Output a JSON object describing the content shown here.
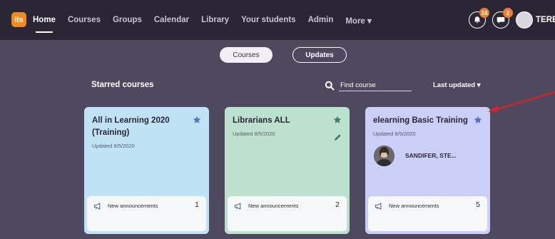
{
  "app": {
    "logo_text": "its"
  },
  "nav": {
    "items": [
      {
        "label": "Home",
        "active": true
      },
      {
        "label": "Courses",
        "active": false
      },
      {
        "label": "Groups",
        "active": false
      },
      {
        "label": "Calendar",
        "active": false
      },
      {
        "label": "Library",
        "active": false
      },
      {
        "label": "Your students",
        "active": false
      },
      {
        "label": "Admin",
        "active": false
      },
      {
        "label": "More ▾",
        "active": false
      }
    ],
    "notifications_count": "18",
    "messages_count": "2",
    "user_name": "TERES"
  },
  "toggle": {
    "courses_label": "Courses",
    "updates_label": "Updates"
  },
  "section": {
    "title": "Starred courses",
    "search_placeholder": "Find course",
    "sort_label": "Last updated ▾"
  },
  "cards": [
    {
      "title": "All in Learning 2020 (Training)",
      "updated": "Updated 8/5/2020",
      "announcements_label": "New announcements",
      "announcements_count": "1"
    },
    {
      "title": "Librarians ALL",
      "updated": "Updated 8/5/2020",
      "announcements_label": "New announcements",
      "announcements_count": "2"
    },
    {
      "title": "elearning Basic Training",
      "updated": "Updated 8/5/2020",
      "teacher": "SANDIFER, STE...",
      "announcements_label": "New announcements",
      "announcements_count": "5"
    }
  ],
  "colors": {
    "topbar": "#2b2636",
    "background": "#4f4960",
    "accent_orange": "#f07b2a",
    "card_blue": "#bfe3f4",
    "card_green": "#bde1cf",
    "card_purple": "#c9cff6",
    "star": "#5a79b5",
    "annotation_arrow": "#e02020"
  }
}
